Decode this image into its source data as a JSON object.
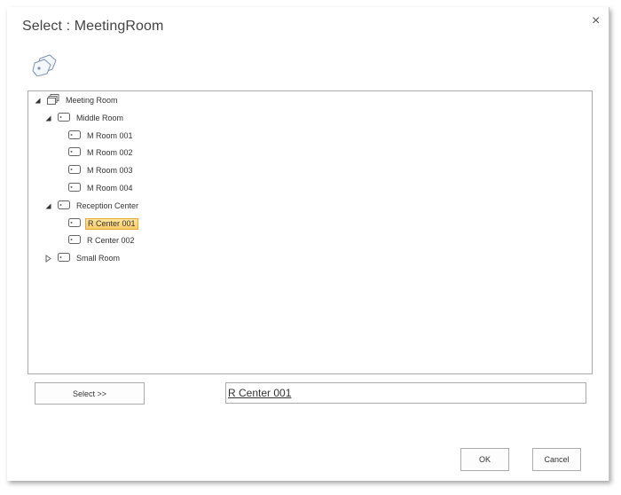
{
  "dialog": {
    "title": "Select : MeetingRoom",
    "close_label": "×"
  },
  "tree": {
    "nodes": [
      {
        "label": "Meeting Room",
        "expander": "expanded",
        "icon": "meeting-room-icon",
        "selected": false
      },
      {
        "label": "Middle Room",
        "expander": "expanded",
        "icon": "room-tag-icon",
        "selected": false
      },
      {
        "label": "M Room 001",
        "expander": "none",
        "icon": "room-tag-icon",
        "selected": false
      },
      {
        "label": "M Room 002",
        "expander": "none",
        "icon": "room-tag-icon",
        "selected": false
      },
      {
        "label": "M Room 003",
        "expander": "none",
        "icon": "room-tag-icon",
        "selected": false
      },
      {
        "label": "M Room 004",
        "expander": "none",
        "icon": "room-tag-icon",
        "selected": false
      },
      {
        "label": "Reception Center",
        "expander": "expanded",
        "icon": "room-tag-icon",
        "selected": false
      },
      {
        "label": "R Center 001",
        "expander": "none",
        "icon": "room-tag-icon",
        "selected": true
      },
      {
        "label": "R Center 002",
        "expander": "none",
        "icon": "room-tag-icon",
        "selected": false
      },
      {
        "label": "Small Room",
        "expander": "collapsed",
        "icon": "room-tag-icon",
        "selected": false
      }
    ]
  },
  "select_button": {
    "label": "Select >>"
  },
  "selected_value": {
    "text": "R Center 001"
  },
  "footer": {
    "ok_label": "OK",
    "cancel_label": "Cancel"
  },
  "colors": {
    "selection_fill": "#f8cc6a",
    "selection_border": "#e6a93a",
    "border": "#a9a9a9"
  }
}
